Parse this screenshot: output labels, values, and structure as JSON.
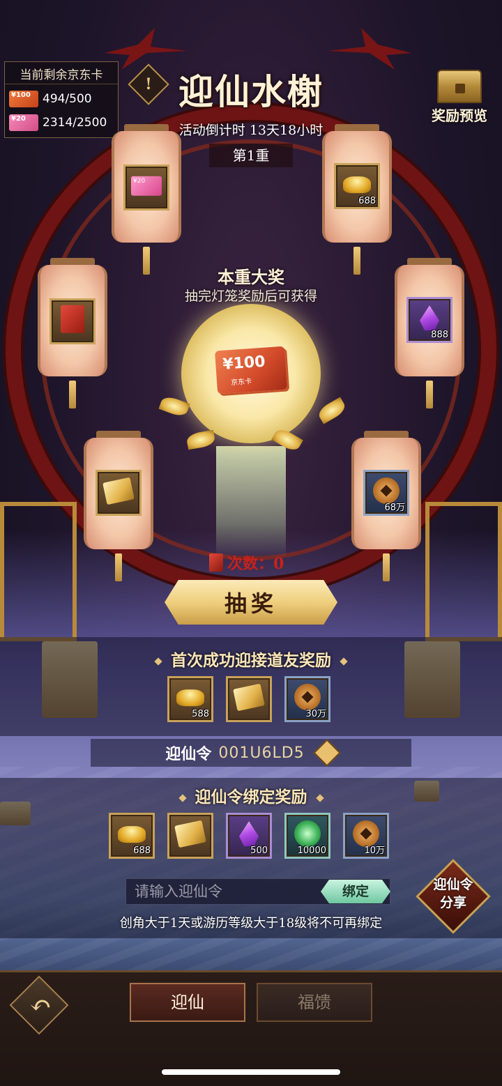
{
  "card_panel": {
    "title": "当前剩余京东卡",
    "cards": [
      {
        "chip": "¥100",
        "count": "494/500",
        "color": "#e8642e"
      },
      {
        "chip": "¥20",
        "count": "2314/2500",
        "color": "#e86aa2"
      }
    ]
  },
  "header": {
    "info_icon": "!",
    "title": "迎仙水榭",
    "countdown": "活动倒计时 13天18小时",
    "tier": "第1重",
    "reward_preview_label": "奖励预览"
  },
  "lanterns": [
    {
      "icon": "pink-card-icon",
      "chip": "¥20",
      "qty": ""
    },
    {
      "icon": "gold-ingot-icon",
      "qty": "688"
    },
    {
      "icon": "red-envelope-icon",
      "qty": ""
    },
    {
      "icon": "purple-gem-icon",
      "qty": "888"
    },
    {
      "icon": "gold-ticket-icon",
      "qty": ""
    },
    {
      "icon": "copper-coin-icon",
      "qty": "68万"
    }
  ],
  "grand_prize": {
    "title": "本重大奖",
    "subtitle": "抽完灯笼奖励后可获得",
    "card_amount": "¥100",
    "card_label": "京东卡"
  },
  "draw": {
    "count_label": "次数：0",
    "button_label": "抽奖"
  },
  "first_success": {
    "title": "首次成功迎接道友奖励",
    "items": [
      {
        "icon": "gold-ingot-icon",
        "qty": "588"
      },
      {
        "icon": "gold-ticket-icon",
        "qty": ""
      },
      {
        "icon": "copper-coin-icon",
        "qty": "30万"
      }
    ]
  },
  "invite_code": {
    "label": "迎仙令",
    "code": "001U6LD5"
  },
  "bind_reward": {
    "title": "迎仙令绑定奖励",
    "items": [
      {
        "icon": "gold-ingot-icon",
        "qty": "688"
      },
      {
        "icon": "gold-ticket-icon",
        "qty": ""
      },
      {
        "icon": "purple-gem-icon",
        "qty": "500"
      },
      {
        "icon": "jade-orb-icon",
        "qty": "10000"
      },
      {
        "icon": "copper-coin-icon",
        "qty": "10万"
      }
    ],
    "input_placeholder": "请输入迎仙令",
    "bind_button": "绑定",
    "share_button_line1": "迎仙令",
    "share_button_line2": "分享",
    "notice": "创角大于1天或游历等级大于18级将不可再绑定"
  },
  "bottom_nav": {
    "back_icon": "back-arrow-icon",
    "tabs": [
      "迎仙",
      "福馈"
    ],
    "active_tab": "迎仙"
  }
}
